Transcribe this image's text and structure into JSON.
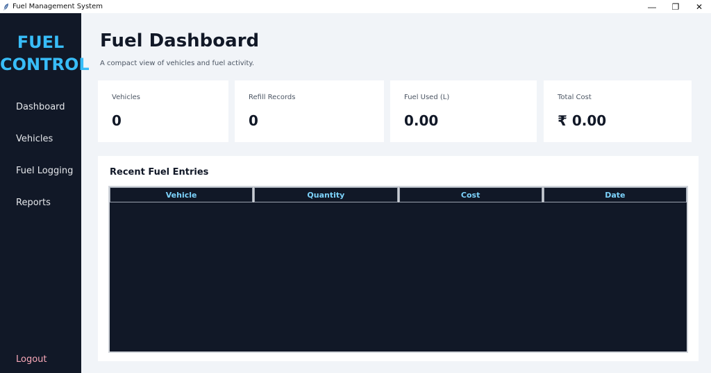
{
  "window": {
    "title": "Fuel Management System",
    "minimize_glyph": "—",
    "maximize_glyph": "❐",
    "close_glyph": "✕"
  },
  "sidebar": {
    "logo_line1": "FUEL",
    "logo_line2": "CONTROL",
    "items": [
      {
        "label": "Dashboard"
      },
      {
        "label": "Vehicles"
      },
      {
        "label": "Fuel Logging"
      },
      {
        "label": "Reports"
      }
    ],
    "logout_label": "Logout"
  },
  "header": {
    "title": "Fuel Dashboard",
    "subtitle": "A compact view of vehicles and fuel activity."
  },
  "stats": [
    {
      "label": "Vehicles",
      "value": "0"
    },
    {
      "label": "Refill Records",
      "value": "0"
    },
    {
      "label": "Fuel Used (L)",
      "value": "0.00"
    },
    {
      "label": "Total Cost",
      "value": "₹ 0.00"
    }
  ],
  "recent": {
    "title": "Recent Fuel Entries",
    "columns": [
      "Vehicle",
      "Quantity",
      "Cost",
      "Date"
    ],
    "rows": []
  },
  "colors": {
    "sidebar_bg": "#111827",
    "accent": "#38bdf8",
    "logout": "#f9a8b8",
    "header_text": "#7dd3fc"
  }
}
